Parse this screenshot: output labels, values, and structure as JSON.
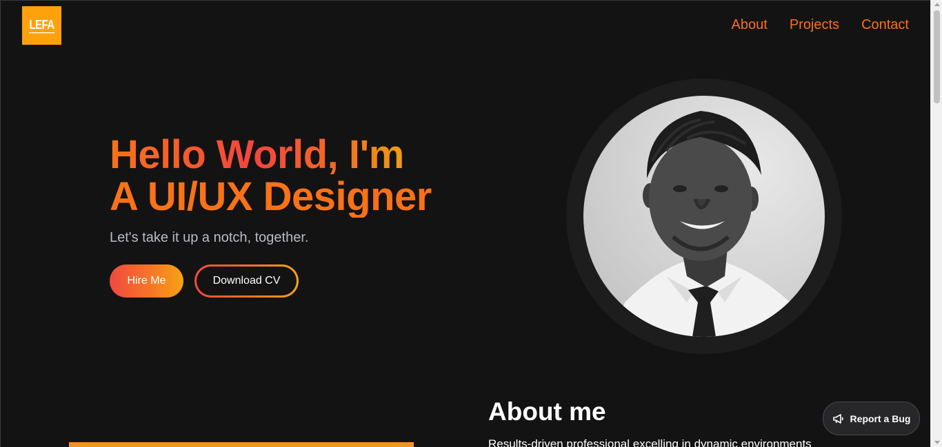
{
  "header": {
    "logo_text": "LEFA",
    "nav": [
      {
        "label": "About"
      },
      {
        "label": "Projects"
      },
      {
        "label": "Contact"
      }
    ]
  },
  "hero": {
    "title_line1": "Hello World, I'm",
    "title_line2": "A UI/UX Designer",
    "subtitle": "Let's take it up a notch, together.",
    "hire_label": "Hire Me",
    "cv_label": "Download CV"
  },
  "about": {
    "title": "About me",
    "text": "Results-driven professional excelling in dynamic environments"
  },
  "report_bug": {
    "label": "Report a Bug",
    "icon": "megaphone-icon"
  },
  "colors": {
    "background": "#141314",
    "accent": "#f9711f",
    "logo_bg": "#ffa10a"
  }
}
